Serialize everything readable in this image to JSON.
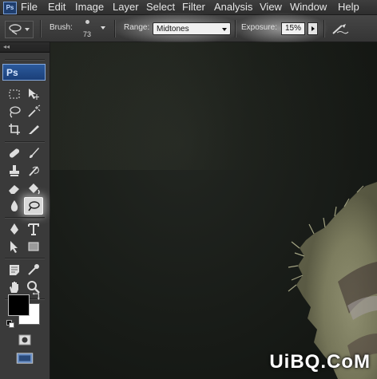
{
  "menubar": {
    "app_icon": "Ps",
    "items": [
      "File",
      "Edit",
      "Image",
      "Layer",
      "Select",
      "Filter",
      "Analysis",
      "View",
      "Window",
      "Help"
    ]
  },
  "options": {
    "tool_preset_icon": "dodge-icon",
    "brush_label": "Brush:",
    "brush_size": "73",
    "range_label": "Range:",
    "range_value": "Midtones",
    "exposure_label": "Exposure:",
    "exposure_value": "15%",
    "airbrush_icon": "airbrush-icon"
  },
  "toolbox": {
    "logo": "Ps",
    "active_tool": "dodge-tool",
    "foreground_color": "#000000",
    "background_color": "#ffffff"
  },
  "watermark": "UiBQ.CoM",
  "colors": {
    "menubar": "#333333",
    "toolbox": "#3a3a3a",
    "canvas": "#1b1f1a",
    "logo_blue": "#1b3f78"
  }
}
